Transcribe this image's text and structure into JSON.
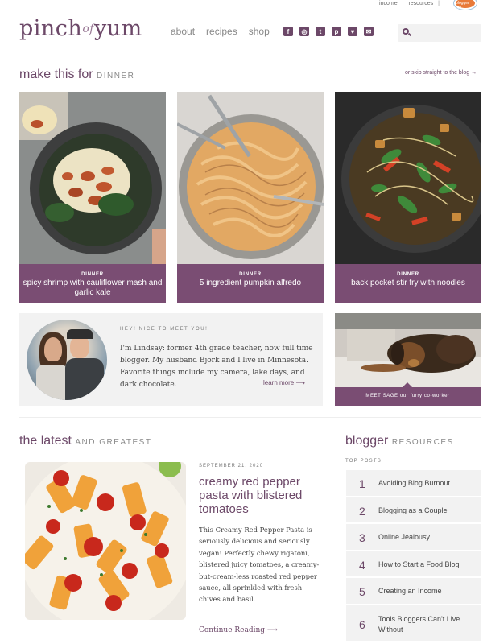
{
  "topbar": {
    "links": [
      "income",
      "resources"
    ],
    "badge_text": "food blogger pro"
  },
  "header": {
    "logo": {
      "part1": "pinch",
      "part2": "of",
      "part3": "yum"
    },
    "nav": [
      "about",
      "recipes",
      "shop"
    ],
    "social_icons": [
      "facebook-icon",
      "instagram-icon",
      "twitter-icon",
      "pinterest-icon",
      "heart-icon",
      "email-icon"
    ],
    "search": {
      "placeholder": "",
      "value": ""
    }
  },
  "featured": {
    "heading": "make this for",
    "heading_small": "DINNER",
    "skip_link": "or skip straight to the blog",
    "cards": [
      {
        "category": "DINNER",
        "title": "spicy shrimp with cauliflower mash and garlic kale"
      },
      {
        "category": "DINNER",
        "title": "5 ingredient pumpkin alfredo"
      },
      {
        "category": "DINNER",
        "title": "back pocket stir fry with noodles"
      }
    ]
  },
  "about": {
    "greeting": "HEY! NICE TO MEET YOU!",
    "bio": "I'm Lindsay: former 4th grade teacher, now full time blogger. My husband Bjork and I live in Minnesota. Favorite things include my camera, lake days, and dark chocolate.",
    "learn_more": "learn more"
  },
  "sage": {
    "caption": "MEET SAGE our furry co-worker"
  },
  "latest": {
    "heading": "the latest",
    "heading_small": "AND GREATEST",
    "post": {
      "date": "SEPTEMBER 21, 2020",
      "title": "creamy red pepper pasta with blistered tomatoes",
      "excerpt": "This Creamy Red Pepper Pasta is seriously delicious and seriously vegan! Perfectly chewy rigatoni, blistered juicy tomatoes, a creamy-but-cream-less roasted red pepper sauce, all sprinkled with fresh chives and basil.",
      "continue": "Continue Reading"
    }
  },
  "resources": {
    "heading": "blogger",
    "heading_small": "RESOURCES",
    "label": "TOP POSTS",
    "items": [
      {
        "num": "1",
        "label": "Avoiding Blog Burnout"
      },
      {
        "num": "2",
        "label": "Blogging as a Couple"
      },
      {
        "num": "3",
        "label": "Online Jealousy"
      },
      {
        "num": "4",
        "label": "How to Start a Food Blog"
      },
      {
        "num": "5",
        "label": "Creating an Income"
      },
      {
        "num": "6",
        "label": "Tools Bloggers Can't Live Without"
      }
    ]
  },
  "colors": {
    "accent": "#6c4868",
    "caption_bg": "#7a4d73",
    "panel_bg": "#f2f2f2"
  }
}
